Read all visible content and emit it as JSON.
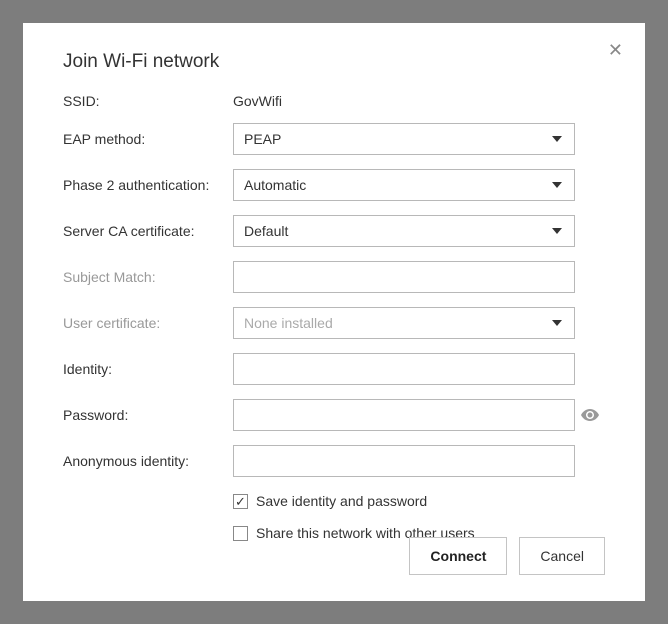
{
  "dialog": {
    "title": "Join Wi-Fi network"
  },
  "form": {
    "ssid": {
      "label": "SSID:",
      "value": "GovWifi"
    },
    "eap_method": {
      "label": "EAP method:",
      "value": "PEAP"
    },
    "phase2": {
      "label": "Phase 2 authentication:",
      "value": "Automatic"
    },
    "server_ca": {
      "label": "Server CA certificate:",
      "value": "Default"
    },
    "subject_match": {
      "label": "Subject Match:",
      "value": ""
    },
    "user_cert": {
      "label": "User certificate:",
      "value": "None installed"
    },
    "identity": {
      "label": "Identity:",
      "value": ""
    },
    "password": {
      "label": "Password:",
      "value": ""
    },
    "anon_identity": {
      "label": "Anonymous identity:",
      "value": ""
    },
    "save_credentials": {
      "label": "Save identity and password",
      "checked": true
    },
    "share_network": {
      "label": "Share this network with other users",
      "checked": false
    }
  },
  "buttons": {
    "connect": "Connect",
    "cancel": "Cancel"
  }
}
